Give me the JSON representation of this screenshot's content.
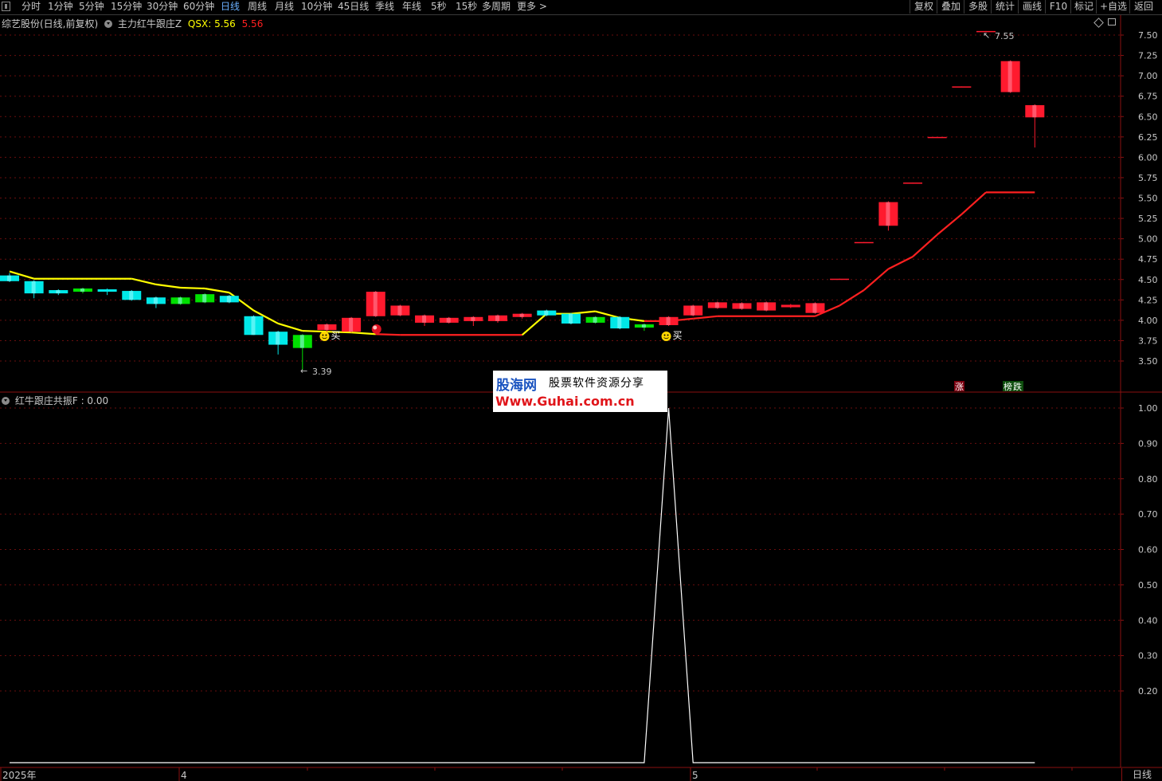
{
  "toolbar": {
    "periods": [
      "分时",
      "1分钟",
      "5分钟",
      "15分钟",
      "30分钟",
      "60分钟",
      "日线",
      "周线",
      "月线",
      "10分钟",
      "45日线",
      "季线",
      "年线",
      "5秒",
      "15秒",
      "多周期",
      "更多 >"
    ],
    "active_period": "日线",
    "right_buttons": [
      "复权",
      "叠加",
      "多股",
      "统计",
      "画线",
      "F10",
      "标记",
      "+自选",
      "返回"
    ]
  },
  "main_panel": {
    "stock_title": "综艺股份(日线,前复权)",
    "indicator_name": "主力红牛跟庄Z",
    "indicator_var": "QSX:",
    "indicator_value_a": "5.56",
    "indicator_value_b": "5.56",
    "price_axis": [
      "7.50",
      "7.25",
      "7.00",
      "6.75",
      "6.50",
      "6.25",
      "6.00",
      "5.75",
      "5.50",
      "5.25",
      "5.00",
      "4.75",
      "4.50",
      "4.25",
      "4.00",
      "3.75",
      "3.50"
    ],
    "high_label": "7.55",
    "low_label": "3.39",
    "buy_label": "买",
    "rise_label": "涨",
    "list_label": "榜",
    "fall_label": "跌",
    "colors": {
      "up": "#ff1a2e",
      "down_cyan": "#00e8e8",
      "down_green": "#00e000",
      "qsx_yellow": "#ffff00",
      "qsx_red": "#ff2020",
      "grid": "#8a1010"
    }
  },
  "sub_panel": {
    "indicator_name": "红牛跟庄共振F",
    "indicator_value": "0.00",
    "value_axis": [
      "1.00",
      "0.90",
      "0.80",
      "0.70",
      "0.60",
      "0.50",
      "0.40",
      "0.30",
      "0.20"
    ],
    "colors": {
      "line": "#ffffff"
    }
  },
  "time_axis": {
    "labels": [
      "2025年",
      "4",
      "5"
    ],
    "period_tag": "日线"
  },
  "watermark": {
    "logo": "股海网",
    "tagline": "股票软件资源分享",
    "url": "Www.Guhai.com.cn"
  },
  "chart_data": {
    "type": "candlestick",
    "price_range": [
      3.3,
      7.65
    ],
    "candles": [
      {
        "o": 4.55,
        "c": 4.48,
        "h": 4.58,
        "l": 4.47,
        "dir": "down"
      },
      {
        "o": 4.48,
        "c": 4.33,
        "h": 4.49,
        "l": 4.27,
        "dir": "down"
      },
      {
        "o": 4.37,
        "c": 4.33,
        "h": 4.38,
        "l": 4.31,
        "dir": "down"
      },
      {
        "o": 4.39,
        "c": 4.35,
        "h": 4.4,
        "l": 4.33,
        "dir": "green"
      },
      {
        "o": 4.38,
        "c": 4.35,
        "h": 4.39,
        "l": 4.31,
        "dir": "down"
      },
      {
        "o": 4.36,
        "c": 4.25,
        "h": 4.37,
        "l": 4.24,
        "dir": "down"
      },
      {
        "o": 4.28,
        "c": 4.2,
        "h": 4.29,
        "l": 4.15,
        "dir": "down"
      },
      {
        "o": 4.28,
        "c": 4.2,
        "h": 4.29,
        "l": 4.19,
        "dir": "green"
      },
      {
        "o": 4.32,
        "c": 4.22,
        "h": 4.33,
        "l": 4.21,
        "dir": "green"
      },
      {
        "o": 4.3,
        "c": 4.22,
        "h": 4.31,
        "l": 4.21,
        "dir": "down"
      },
      {
        "o": 4.05,
        "c": 3.82,
        "h": 4.06,
        "l": 3.82,
        "dir": "down"
      },
      {
        "o": 3.86,
        "c": 3.7,
        "h": 3.87,
        "l": 3.58,
        "dir": "down"
      },
      {
        "o": 3.82,
        "c": 3.66,
        "h": 3.83,
        "l": 3.39,
        "dir": "green"
      },
      {
        "o": 3.88,
        "c": 3.95,
        "h": 3.96,
        "l": 3.86,
        "dir": "up"
      },
      {
        "o": 3.86,
        "c": 4.03,
        "h": 4.04,
        "l": 3.85,
        "dir": "up"
      },
      {
        "o": 4.05,
        "c": 4.35,
        "h": 4.36,
        "l": 4.04,
        "dir": "up"
      },
      {
        "o": 4.06,
        "c": 4.18,
        "h": 4.19,
        "l": 4.05,
        "dir": "up"
      },
      {
        "o": 3.97,
        "c": 4.06,
        "h": 4.07,
        "l": 3.93,
        "dir": "up"
      },
      {
        "o": 3.97,
        "c": 4.03,
        "h": 4.04,
        "l": 3.96,
        "dir": "up"
      },
      {
        "o": 3.99,
        "c": 4.04,
        "h": 4.05,
        "l": 3.93,
        "dir": "up"
      },
      {
        "o": 3.99,
        "c": 4.06,
        "h": 4.07,
        "l": 3.97,
        "dir": "up"
      },
      {
        "o": 4.04,
        "c": 4.08,
        "h": 4.09,
        "l": 4.02,
        "dir": "up"
      },
      {
        "o": 4.12,
        "c": 4.06,
        "h": 4.13,
        "l": 4.05,
        "dir": "down"
      },
      {
        "o": 4.08,
        "c": 3.96,
        "h": 4.09,
        "l": 3.95,
        "dir": "down"
      },
      {
        "o": 4.04,
        "c": 3.97,
        "h": 4.05,
        "l": 3.96,
        "dir": "green"
      },
      {
        "o": 4.04,
        "c": 3.9,
        "h": 4.05,
        "l": 3.89,
        "dir": "down"
      },
      {
        "o": 3.95,
        "c": 3.91,
        "h": 3.96,
        "l": 3.87,
        "dir": "green"
      },
      {
        "o": 3.94,
        "c": 4.04,
        "h": 4.05,
        "l": 3.93,
        "dir": "up"
      },
      {
        "o": 4.06,
        "c": 4.18,
        "h": 4.19,
        "l": 4.05,
        "dir": "up"
      },
      {
        "o": 4.15,
        "c": 4.22,
        "h": 4.23,
        "l": 4.14,
        "dir": "up"
      },
      {
        "o": 4.14,
        "c": 4.21,
        "h": 4.22,
        "l": 4.13,
        "dir": "up"
      },
      {
        "o": 4.12,
        "c": 4.22,
        "h": 4.23,
        "l": 4.11,
        "dir": "up"
      },
      {
        "o": 4.16,
        "c": 4.19,
        "h": 4.2,
        "l": 4.15,
        "dir": "up"
      },
      {
        "o": 4.09,
        "c": 4.21,
        "h": 4.22,
        "l": 4.08,
        "dir": "up"
      },
      {
        "o": 4.5,
        "c": 4.51,
        "h": 4.51,
        "l": 4.5,
        "dir": "up"
      },
      {
        "o": 4.95,
        "c": 4.96,
        "h": 4.96,
        "l": 4.95,
        "dir": "up"
      },
      {
        "o": 5.16,
        "c": 5.45,
        "h": 5.46,
        "l": 5.1,
        "dir": "up"
      },
      {
        "o": 5.68,
        "c": 5.69,
        "h": 5.69,
        "l": 5.68,
        "dir": "up"
      },
      {
        "o": 6.24,
        "c": 6.25,
        "h": 6.25,
        "l": 6.24,
        "dir": "up"
      },
      {
        "o": 6.86,
        "c": 6.87,
        "h": 6.87,
        "l": 6.86,
        "dir": "up"
      },
      {
        "o": 7.54,
        "c": 7.55,
        "h": 7.55,
        "l": 7.54,
        "dir": "up"
      },
      {
        "o": 6.8,
        "c": 7.18,
        "h": 7.19,
        "l": 6.79,
        "dir": "up"
      },
      {
        "o": 6.49,
        "c": 6.64,
        "h": 6.65,
        "l": 6.12,
        "dir": "up"
      }
    ],
    "qsx_line": [
      {
        "i": 0,
        "v": 4.6,
        "c": "y"
      },
      {
        "i": 1,
        "v": 4.51,
        "c": "y"
      },
      {
        "i": 5,
        "v": 4.51,
        "c": "y"
      },
      {
        "i": 6,
        "v": 4.44,
        "c": "y"
      },
      {
        "i": 7,
        "v": 4.4,
        "c": "y"
      },
      {
        "i": 8,
        "v": 4.39,
        "c": "y"
      },
      {
        "i": 9,
        "v": 4.34,
        "c": "y"
      },
      {
        "i": 10,
        "v": 4.12,
        "c": "y"
      },
      {
        "i": 11,
        "v": 3.96,
        "c": "y"
      },
      {
        "i": 12,
        "v": 3.87,
        "c": "y"
      },
      {
        "i": 13,
        "v": 3.86,
        "c": "y"
      },
      {
        "i": 14,
        "v": 3.85,
        "c": "y"
      },
      {
        "i": 15,
        "v": 3.83,
        "c": "y"
      },
      {
        "i": 16,
        "v": 3.82,
        "c": "r"
      },
      {
        "i": 21,
        "v": 3.82,
        "c": "r"
      },
      {
        "i": 22,
        "v": 4.08,
        "c": "y"
      },
      {
        "i": 23,
        "v": 4.08,
        "c": "y"
      },
      {
        "i": 24,
        "v": 4.11,
        "c": "y"
      },
      {
        "i": 25,
        "v": 4.03,
        "c": "y"
      },
      {
        "i": 26,
        "v": 3.99,
        "c": "y"
      },
      {
        "i": 27,
        "v": 3.99,
        "c": "r"
      },
      {
        "i": 28,
        "v": 4.02,
        "c": "r"
      },
      {
        "i": 29,
        "v": 4.05,
        "c": "r"
      },
      {
        "i": 33,
        "v": 4.05,
        "c": "r"
      },
      {
        "i": 34,
        "v": 4.18,
        "c": "r"
      },
      {
        "i": 35,
        "v": 4.37,
        "c": "r"
      },
      {
        "i": 36,
        "v": 4.63,
        "c": "r"
      },
      {
        "i": 37,
        "v": 4.78,
        "c": "r"
      },
      {
        "i": 38,
        "v": 5.05,
        "c": "r"
      },
      {
        "i": 39,
        "v": 5.3,
        "c": "r"
      },
      {
        "i": 40,
        "v": 5.57,
        "c": "r"
      },
      {
        "i": 42,
        "v": 5.57,
        "c": "r"
      }
    ],
    "buy_signals": [
      13,
      27
    ],
    "ball_signal": 15,
    "sub_series": {
      "values_nonzero": {
        "27": 1.0
      },
      "length": 43,
      "range": [
        0.1,
        1.05
      ]
    }
  }
}
